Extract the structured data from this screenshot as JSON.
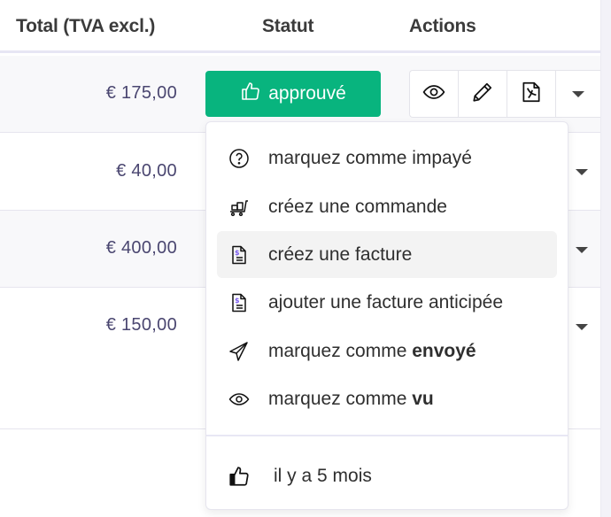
{
  "table": {
    "columns": [
      {
        "key": "total",
        "label": "Total (TVA excl.)"
      },
      {
        "key": "statut",
        "label": "Statut"
      },
      {
        "key": "actions",
        "label": "Actions"
      }
    ],
    "rows": [
      {
        "total": "€ 175,00",
        "statut": "approuvé"
      },
      {
        "total": "€ 40,00"
      },
      {
        "total": "€ 400,00"
      },
      {
        "total": "€ 150,00"
      }
    ]
  },
  "status_button": {
    "label": "approuvé",
    "icon": "thumbs-up-icon",
    "color": "#08b47e"
  },
  "action_buttons": [
    {
      "name": "view",
      "icon": "eye-icon"
    },
    {
      "name": "edit",
      "icon": "pencil-icon"
    },
    {
      "name": "pdf",
      "icon": "pdf-file-icon"
    },
    {
      "name": "more",
      "icon": "caret-down-icon"
    }
  ],
  "dropdown_menu": {
    "items": [
      {
        "icon": "question-circle-icon",
        "text": "marquez comme impayé",
        "bold": ""
      },
      {
        "icon": "cart-icon",
        "text": "créez une commande",
        "bold": ""
      },
      {
        "icon": "invoice-icon",
        "text": "créez une facture",
        "bold": "",
        "highlighted": true
      },
      {
        "icon": "invoice-icon",
        "text": "ajouter une facture anticipée",
        "bold": ""
      },
      {
        "icon": "paper-plane-icon",
        "text": "marquez comme ",
        "bold": "envoyé"
      },
      {
        "icon": "eye-icon",
        "text": "marquez comme ",
        "bold": "vu"
      }
    ],
    "footer": {
      "icon": "thumbs-up-icon",
      "text": "il y a 5 mois"
    }
  },
  "colors": {
    "accent": "#08b47e",
    "amount_text": "#4a4670",
    "invoice_dollar": "#7b5cf0"
  }
}
